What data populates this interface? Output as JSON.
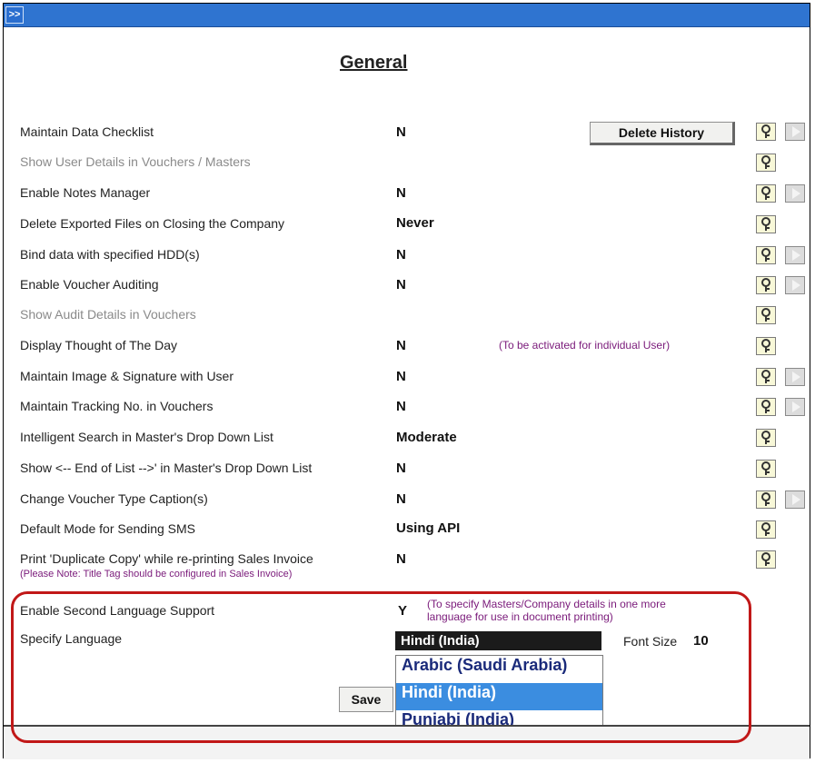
{
  "titlebar": {
    "collapse_label": ">>"
  },
  "page_title": "General",
  "delete_history_label": "Delete History",
  "rows": [
    {
      "label": "Maintain Data Checklist",
      "value": "N",
      "disabled": false
    },
    {
      "label": "Show User Details in Vouchers / Masters",
      "value": "",
      "disabled": true
    },
    {
      "label": "Enable Notes Manager",
      "value": "N",
      "disabled": false
    },
    {
      "label": "Delete Exported Files on Closing the Company",
      "value": "Never",
      "disabled": false
    },
    {
      "label": "Bind data with specified HDD(s)",
      "value": "N",
      "disabled": false
    },
    {
      "label": "Enable Voucher Auditing",
      "value": "N",
      "disabled": false
    },
    {
      "label": "Show Audit Details in Vouchers",
      "value": "",
      "disabled": true
    },
    {
      "label": "Display Thought of The Day",
      "value": "N",
      "disabled": false
    },
    {
      "label": "Maintain Image & Signature with User",
      "value": "N",
      "disabled": false
    },
    {
      "label": "Maintain Tracking No. in Vouchers",
      "value": "N",
      "disabled": false
    },
    {
      "label": "Intelligent Search in Master's Drop Down List",
      "value": "Moderate",
      "disabled": false
    },
    {
      "label": "Show <-- End of List -->' in Master's Drop Down List",
      "value": "N",
      "disabled": false
    },
    {
      "label": "Change Voucher Type Caption(s)",
      "value": "N",
      "disabled": false
    },
    {
      "label": "Default Mode for Sending SMS",
      "value": "Using API",
      "disabled": false
    },
    {
      "label": "Print 'Duplicate Copy' while re-printing Sales Invoice",
      "value": "N",
      "disabled": false,
      "note": "(Please Note: Title Tag should be configured in Sales Invoice)"
    }
  ],
  "thought_note": "(To be activated for individual User)",
  "second_language": {
    "label": "Enable Second Language Support",
    "value": "Y",
    "note_line1": "(To specify Masters/Company details in one more",
    "note_line2": "language for use in document printing)"
  },
  "specify_language": {
    "label": "Specify Language",
    "selected": "Hindi (India)",
    "font_size_label": "Font Size",
    "font_size_value": "10",
    "options": [
      "Arabic (Saudi Arabia)",
      "Hindi (India)",
      "Punjabi (India)"
    ]
  },
  "save_label": "Save",
  "icons": {
    "help": "help-key-icon",
    "arrow": "right-arrow-icon"
  }
}
